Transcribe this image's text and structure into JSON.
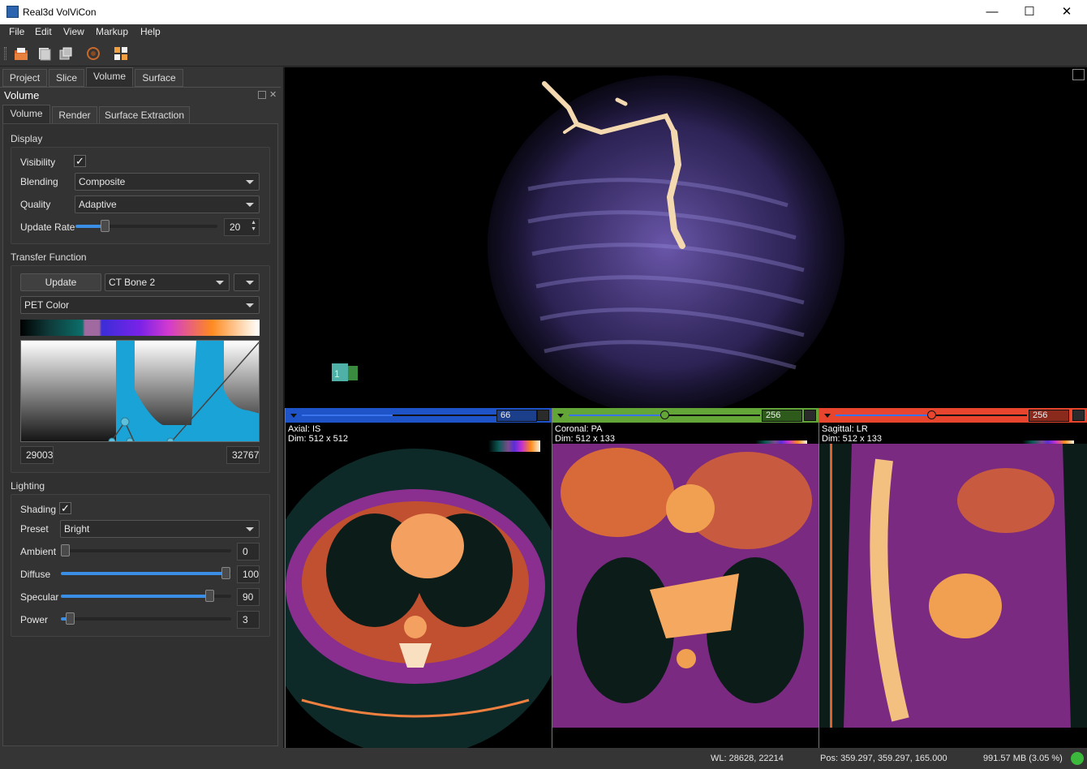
{
  "window": {
    "title": "Real3d VolViCon",
    "minimize": "—",
    "maximize": "☐",
    "close": "✕"
  },
  "menu": [
    "File",
    "Edit",
    "View",
    "Markup",
    "Help"
  ],
  "toolbar_icons": [
    "open-icon",
    "load-icon",
    "cubes-icon",
    "dicom-icon",
    "layout-icon"
  ],
  "main_tabs": [
    "Project",
    "Slice",
    "Volume",
    "Surface"
  ],
  "panel": {
    "title": "Volume",
    "sub_tabs": [
      "Volume",
      "Render",
      "Surface Extraction"
    ]
  },
  "display": {
    "label": "Display",
    "visibility_label": "Visibility",
    "visibility_checked": true,
    "blending_label": "Blending",
    "blending_value": "Composite",
    "quality_label": "Quality",
    "quality_value": "Adaptive",
    "update_rate_label": "Update Rate",
    "update_rate_value": "20"
  },
  "transfer_function": {
    "label": "Transfer Function",
    "update_button": "Update",
    "preset_value": "CT Bone 2",
    "colormap_value": "PET Color",
    "min_value": "29003",
    "max_value": "32767"
  },
  "lighting": {
    "label": "Lighting",
    "shading_label": "Shading",
    "shading_checked": true,
    "preset_label": "Preset",
    "preset_value": "Bright",
    "ambient_label": "Ambient",
    "ambient_value": "0",
    "diffuse_label": "Diffuse",
    "diffuse_value": "100",
    "specular_label": "Specular",
    "specular_value": "90",
    "power_label": "Power",
    "power_value": "3"
  },
  "slices": {
    "axial": {
      "value": "66",
      "line1": "Axial: IS",
      "line2": "Dim: 512 x 512",
      "color": "#1f54c9"
    },
    "coronal": {
      "value": "256",
      "line1": "Coronal: PA",
      "line2": "Dim: 512 x 133",
      "color": "#64a538"
    },
    "sagittal": {
      "value": "256",
      "line1": "Sagittal: LR",
      "line2": "Dim: 512 x 133",
      "color": "#e8452f"
    }
  },
  "status": {
    "wl": "WL: 28628, 22214",
    "pos": "Pos: 359.297, 359.297, 165.000",
    "memory": "991.57 MB (3.05 %)",
    "indicator_color": "#3cb83c"
  }
}
